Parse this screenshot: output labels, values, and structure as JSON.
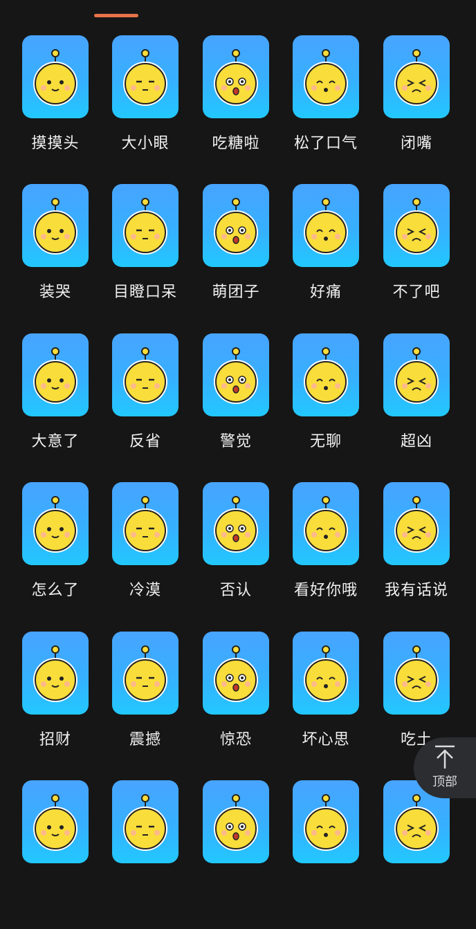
{
  "accent_color": "#e8734a",
  "tile_color": "#3aaaff",
  "face_color": "#f9dd3a",
  "stickers": [
    {
      "label": "摸摸头",
      "icon": "pat-head-icon"
    },
    {
      "label": "大小眼",
      "icon": "uneven-eyes-icon"
    },
    {
      "label": "吃糖啦",
      "icon": "eating-candy-icon"
    },
    {
      "label": "松了口气",
      "icon": "relieved-icon"
    },
    {
      "label": "闭嘴",
      "icon": "mouth-shut-icon"
    },
    {
      "label": "装哭",
      "icon": "fake-cry-icon"
    },
    {
      "label": "目瞪口呆",
      "icon": "stunned-icon"
    },
    {
      "label": "萌团子",
      "icon": "cute-dumpling-icon"
    },
    {
      "label": "好痛",
      "icon": "hurts-icon"
    },
    {
      "label": "不了吧",
      "icon": "no-thanks-icon"
    },
    {
      "label": "大意了",
      "icon": "careless-cat-icon"
    },
    {
      "label": "反省",
      "icon": "reflect-icon"
    },
    {
      "label": "警觉",
      "icon": "alert-icon"
    },
    {
      "label": "无聊",
      "icon": "bored-icon"
    },
    {
      "label": "超凶",
      "icon": "fierce-icon"
    },
    {
      "label": "怎么了",
      "icon": "whats-wrong-icon"
    },
    {
      "label": "冷漠",
      "icon": "indifferent-icon"
    },
    {
      "label": "否认",
      "icon": "deny-icon"
    },
    {
      "label": "看好你哦",
      "icon": "believe-in-you-icon"
    },
    {
      "label": "我有话说",
      "icon": "something-to-say-icon"
    },
    {
      "label": "招财",
      "icon": "lucky-dog-icon"
    },
    {
      "label": "震撼",
      "icon": "shocked-icon"
    },
    {
      "label": "惊恐",
      "icon": "terrified-icon"
    },
    {
      "label": "坏心思",
      "icon": "mischief-icon"
    },
    {
      "label": "吃土",
      "icon": "eat-dirt-icon"
    },
    {
      "label": "",
      "icon": "happy-icon"
    },
    {
      "label": "",
      "icon": "sigh-icon"
    },
    {
      "label": "",
      "icon": "stare-icon"
    },
    {
      "label": "",
      "icon": "angry-icon"
    },
    {
      "label": "",
      "icon": "crying-icon"
    }
  ],
  "back_to_top": {
    "label": "顶部",
    "icon": "arrow-up-icon"
  }
}
